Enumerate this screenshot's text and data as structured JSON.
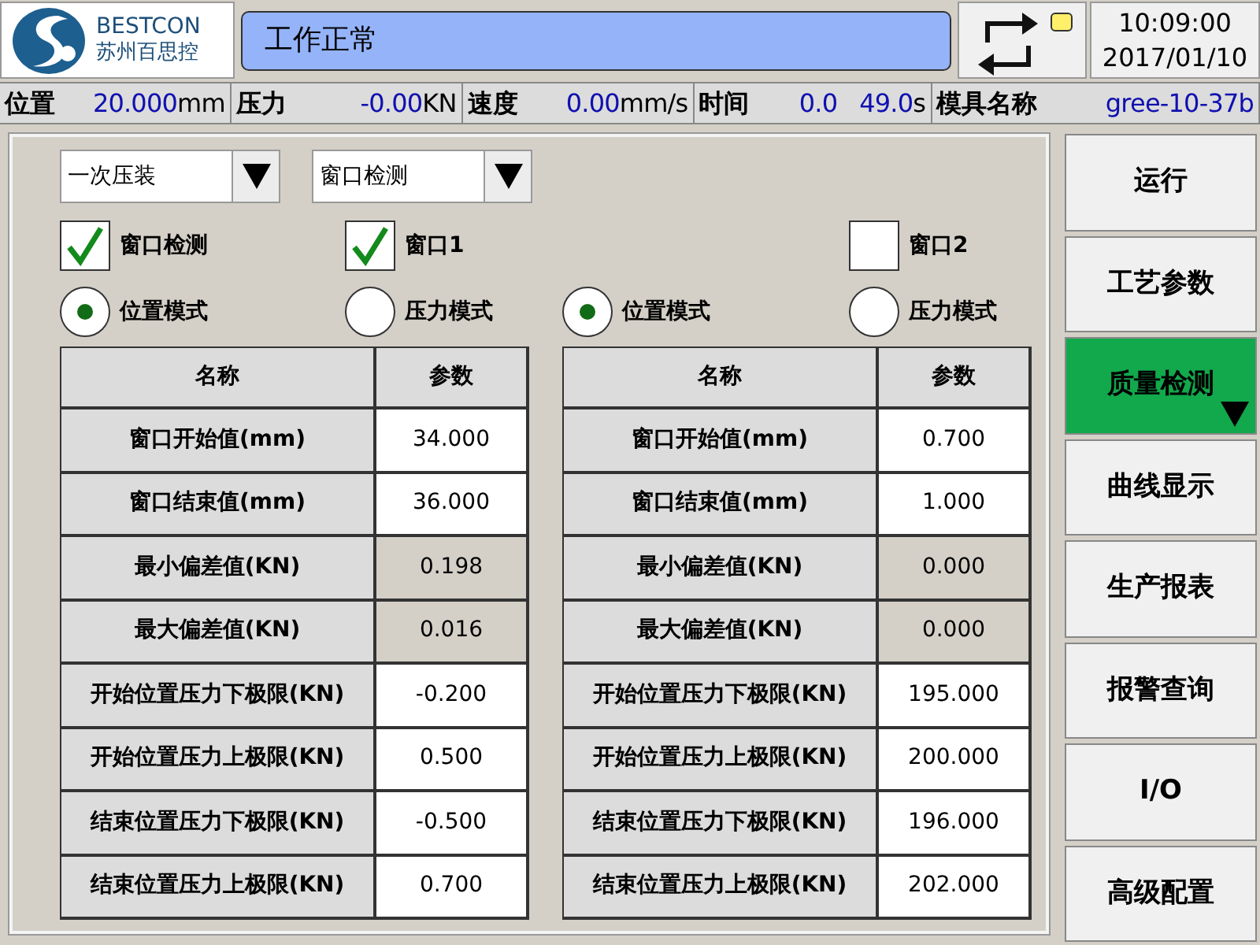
{
  "header": {
    "brand": "BESTCON",
    "brand_subtitle": "苏州百思控",
    "status_message": "工作正常",
    "time": "10:09:00",
    "date": "2017/01/10"
  },
  "status_bar": [
    {
      "label": "位置",
      "values": [
        "20.000"
      ],
      "unit": "mm"
    },
    {
      "label": "压力",
      "values": [
        "-0.00"
      ],
      "unit": "KN"
    },
    {
      "label": "速度",
      "values": [
        "0.00"
      ],
      "unit": "mm/s"
    },
    {
      "label": "时间",
      "values": [
        "0.0",
        "49.0"
      ],
      "unit": "s"
    },
    {
      "label": "模具名称",
      "values": [
        "gree-10-37b"
      ]
    }
  ],
  "dropdowns": [
    {
      "value": "一次压装"
    },
    {
      "value": "窗口检测"
    }
  ],
  "checkboxes": [
    {
      "label": "窗口检测",
      "checked": true
    },
    {
      "label": "窗口1",
      "checked": true
    },
    {
      "label": "窗口2",
      "checked": false
    }
  ],
  "radio_groups": [
    {
      "options": [
        {
          "label": "位置模式",
          "selected": true
        },
        {
          "label": "压力模式",
          "selected": false
        }
      ]
    },
    {
      "options": [
        {
          "label": "位置模式",
          "selected": true
        },
        {
          "label": "压力模式",
          "selected": false
        }
      ]
    }
  ],
  "tables": [
    {
      "columns": [
        "名称",
        "参数"
      ],
      "rows": [
        {
          "name": "窗口开始值(mm)",
          "value": "34.000",
          "readonly": false
        },
        {
          "name": "窗口结束值(mm)",
          "value": "36.000",
          "readonly": false
        },
        {
          "name": "最小偏差值(KN)",
          "value": "0.198",
          "readonly": true
        },
        {
          "name": "最大偏差值(KN)",
          "value": "0.016",
          "readonly": true
        },
        {
          "name": "开始位置压力下极限(KN)",
          "value": "-0.200",
          "readonly": false
        },
        {
          "name": "开始位置压力上极限(KN)",
          "value": "0.500",
          "readonly": false
        },
        {
          "name": "结束位置压力下极限(KN)",
          "value": "-0.500",
          "readonly": false
        },
        {
          "name": "结束位置压力上极限(KN)",
          "value": "0.700",
          "readonly": false
        }
      ]
    },
    {
      "columns": [
        "名称",
        "参数"
      ],
      "rows": [
        {
          "name": "窗口开始值(mm)",
          "value": "0.700",
          "readonly": false
        },
        {
          "name": "窗口结束值(mm)",
          "value": "1.000",
          "readonly": false
        },
        {
          "name": "最小偏差值(KN)",
          "value": "0.000",
          "readonly": true
        },
        {
          "name": "最大偏差值(KN)",
          "value": "0.000",
          "readonly": true
        },
        {
          "name": "开始位置压力下极限(KN)",
          "value": "195.000",
          "readonly": false
        },
        {
          "name": "开始位置压力上极限(KN)",
          "value": "200.000",
          "readonly": false
        },
        {
          "name": "结束位置压力下极限(KN)",
          "value": "196.000",
          "readonly": false
        },
        {
          "name": "结束位置压力上极限(KN)",
          "value": "202.000",
          "readonly": false
        }
      ]
    }
  ],
  "nav": [
    {
      "label": "运行",
      "selected": false
    },
    {
      "label": "工艺参数",
      "selected": false
    },
    {
      "label": "质量检测",
      "selected": true
    },
    {
      "label": "曲线显示",
      "selected": false
    },
    {
      "label": "生产报表",
      "selected": false
    },
    {
      "label": "报警查询",
      "selected": false
    },
    {
      "label": "I/O",
      "selected": false
    },
    {
      "label": "高级配置",
      "selected": false
    }
  ]
}
